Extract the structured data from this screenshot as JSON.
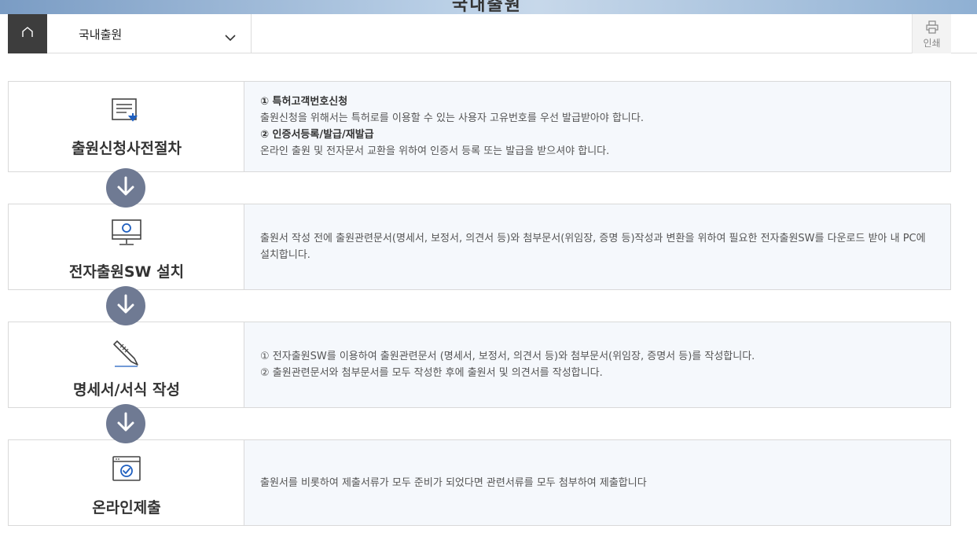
{
  "header": {
    "banner_title": "국내출원"
  },
  "nav": {
    "home_label": "",
    "dropdown_value": "국내출원",
    "print_label": "인쇄"
  },
  "steps": [
    {
      "title": "출원신청사전절차",
      "icon": "document-download-icon",
      "lines": [
        {
          "text": "① 특허고객번호신청",
          "bold": true
        },
        {
          "text": "출원신청을 위해서는 특허로를 이용할 수 있는 사용자 고유번호를 우선 발급받아야 합니다.",
          "bold": false
        },
        {
          "text": "② 인증서등록/발급/재발급",
          "bold": true
        },
        {
          "text": "온라인 출원 및 전자문서 교환을 위하여 인증서 등록 또는 발급을 받으셔야 합니다.",
          "bold": false
        }
      ]
    },
    {
      "title": "전자출원SW 설치",
      "icon": "monitor-icon",
      "lines": [
        {
          "text": "출원서 작성 전에 출원관련문서(명세서, 보정서, 의견서 등)와 첨부문서(위임장, 증명 등)작성과 변환을 위하여 필요한 전자출원SW를 다운로드 받아 내 PC에 설치합니다.",
          "bold": false
        }
      ]
    },
    {
      "title": "명세서/서식 작성",
      "icon": "pencil-icon",
      "lines": [
        {
          "text": "① 전자출원SW를 이용하여 출원관련문서 (명세서, 보정서, 의견서 등)와 첨부문서(위임장, 증명서 등)를 작성합니다.",
          "bold": false
        },
        {
          "text": "② 출원관련문서와 첨부문서를 모두 작성한 후에 출원서 및 의견서를 작성합니다.",
          "bold": false
        }
      ]
    },
    {
      "title": "온라인제출",
      "icon": "browser-check-icon",
      "lines": [
        {
          "text": "출원서를 비롯하여 제출서류가 모두 준비가 되었다면 관련서류를 모두 첨부하여 제출합니다",
          "bold": false
        }
      ]
    }
  ],
  "colors": {
    "arrow_circle": "#6f7a93",
    "home_bg": "#3d3d3d",
    "icon_blue": "#1f5fbf"
  }
}
